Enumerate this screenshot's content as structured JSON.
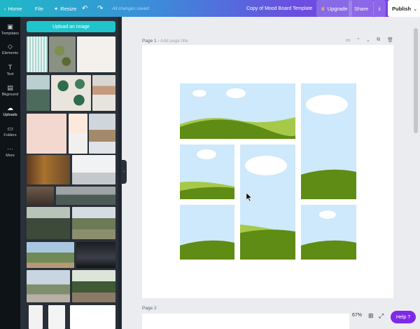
{
  "topbar": {
    "home": "Home",
    "file": "File",
    "resize": "Resize",
    "saved_status": "All changes saved",
    "title": "Copy of Mood Board Template",
    "upgrade": "Upgrade",
    "share": "Share",
    "publish": "Publish"
  },
  "rail": {
    "items": [
      {
        "label": "Templates",
        "icon": "template-icon"
      },
      {
        "label": "Elements",
        "icon": "shapes-icon"
      },
      {
        "label": "Text",
        "icon": "text-icon"
      },
      {
        "label": "Bkground",
        "icon": "background-icon"
      },
      {
        "label": "Uploads",
        "icon": "cloud-upload-icon"
      },
      {
        "label": "Folders",
        "icon": "folder-icon"
      },
      {
        "label": "More",
        "icon": "more-dots-icon"
      }
    ]
  },
  "panel": {
    "upload_button": "Upload an image"
  },
  "canvas": {
    "page1_label": "Page 1",
    "page1_title_placeholder": "Add page title",
    "page2_label": "Page 2"
  },
  "footer": {
    "zoom": "67%",
    "help": "Help ?"
  },
  "colors": {
    "accent_teal": "#20c4cb",
    "brand_purple": "#7d2ae8",
    "sky": "#cde9fb",
    "hill_light": "#a7c94a",
    "hill_dark": "#5f8c14"
  }
}
